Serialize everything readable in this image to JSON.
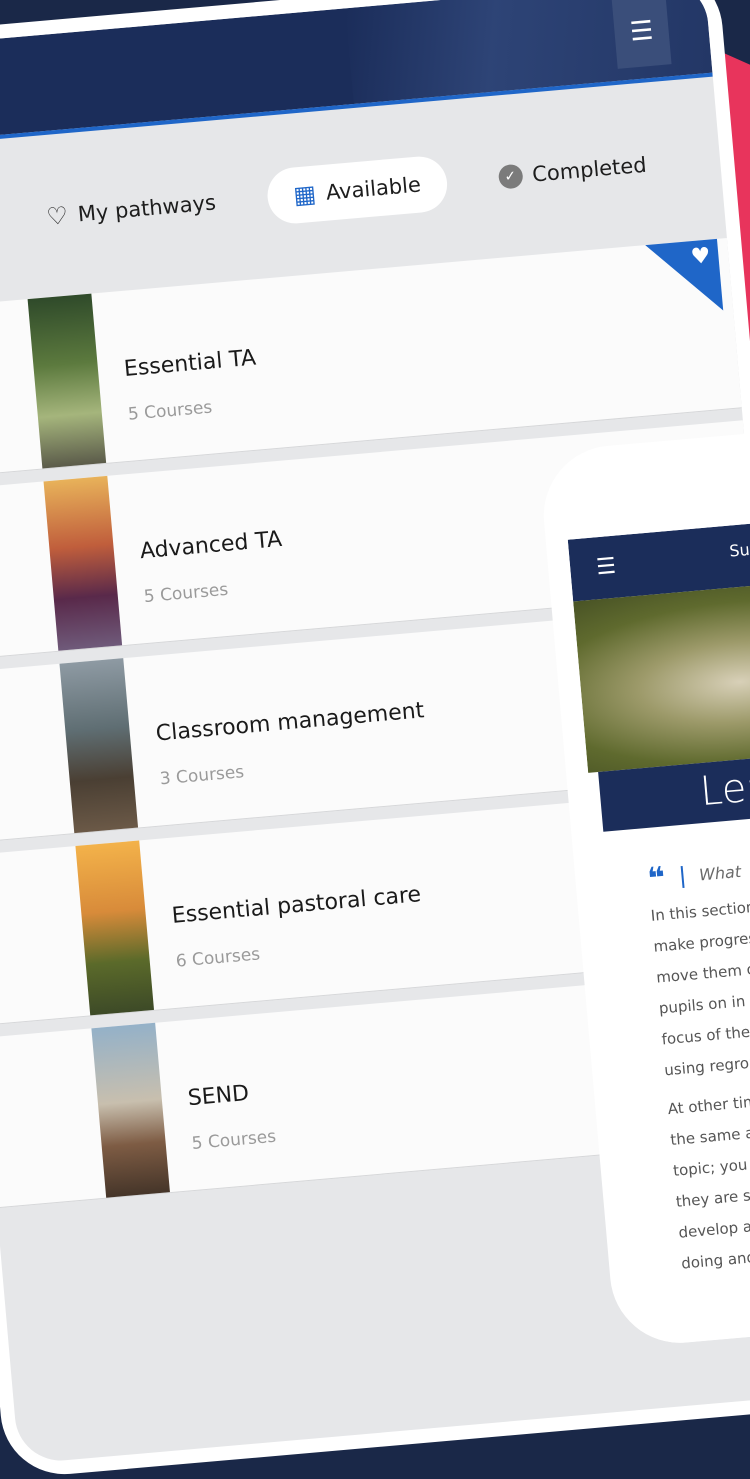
{
  "tablet": {
    "menu_icon": "hamburger-icon",
    "tabs": [
      {
        "label": "My pathways",
        "icon": "heart-outline-icon",
        "active": false
      },
      {
        "label": "Available",
        "icon": "qr-code-icon",
        "active": true
      },
      {
        "label": "Completed",
        "icon": "check-badge-icon",
        "active": false
      }
    ],
    "pathways": [
      {
        "title": "Essential TA",
        "count": "5 Courses",
        "favorite": true
      },
      {
        "title": "Advanced TA",
        "count": "5 Courses",
        "favorite": false
      },
      {
        "title": "Classroom management",
        "count": "3 Courses",
        "favorite": false
      },
      {
        "title": "Essential pastoral care",
        "count": "6 Courses",
        "favorite": false
      },
      {
        "title": "SEND",
        "count": "5 Courses",
        "favorite": false
      }
    ]
  },
  "phone": {
    "header_title": "Su",
    "banner": "Lea",
    "quote": "What",
    "paragraph1": [
      "In this section",
      "make progress",
      "move them on",
      "pupils on in a",
      "focus of the le",
      "using regroup"
    ],
    "paragraph2": [
      "At other time",
      "the same are",
      "topic; you mi",
      "they are secu",
      "develop a de",
      "doing and w"
    ]
  },
  "colors": {
    "navy": "#1b2d5a",
    "accent_blue": "#1f66c8",
    "pink": "#e8345c",
    "background": "#1a2848"
  }
}
